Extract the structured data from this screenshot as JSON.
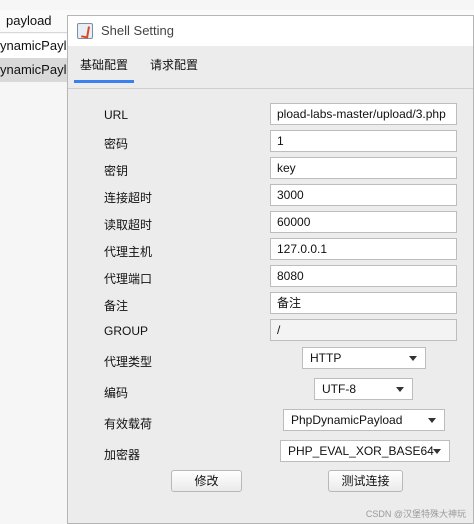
{
  "background_app": {
    "column_header": "payload",
    "rows": [
      "ynamicPayl",
      "ynamicPaylc"
    ]
  },
  "dialog": {
    "title": "Shell Setting",
    "tabs": [
      "基础配置",
      "请求配置"
    ],
    "fields": {
      "url": {
        "label": "URL",
        "value": "pload-labs-master/upload/3.php"
      },
      "password": {
        "label": "密码",
        "value": "1"
      },
      "key": {
        "label": "密钥",
        "value": "key"
      },
      "connect_timeout": {
        "label": "连接超时",
        "value": "3000"
      },
      "read_timeout": {
        "label": "读取超时",
        "value": "60000"
      },
      "proxy_host": {
        "label": "代理主机",
        "value": "127.0.0.1"
      },
      "proxy_port": {
        "label": "代理端口",
        "value": "8080"
      },
      "remark": {
        "label": "备注",
        "value": "备注"
      },
      "group": {
        "label": "GROUP",
        "value": "/"
      }
    },
    "selects": {
      "proxy_type": {
        "label": "代理类型",
        "value": "HTTP"
      },
      "encoding": {
        "label": "编码",
        "value": "UTF-8"
      },
      "payload": {
        "label": "有效载荷",
        "value": "PhpDynamicPayload"
      },
      "encryptor": {
        "label": "加密器",
        "value": "PHP_EVAL_XOR_BASE64"
      }
    },
    "buttons": {
      "modify": "修改",
      "test_connection": "测试连接"
    }
  },
  "watermark": "CSDN @汉堡特殊大神玩"
}
